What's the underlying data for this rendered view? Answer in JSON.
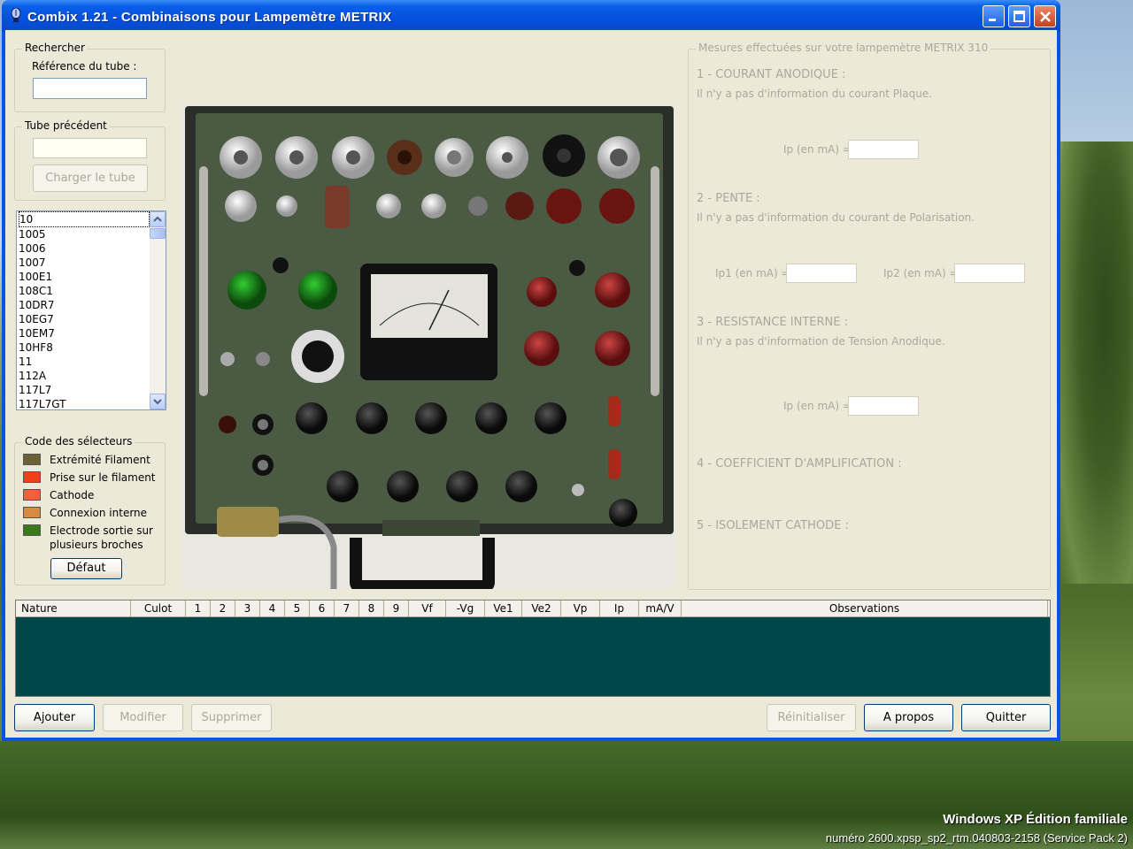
{
  "os": {
    "edition": "Windows XP Édition familiale",
    "build": "numéro 2600.xpsp_sp2_rtm.040803-2158 (Service Pack 2)"
  },
  "window": {
    "title": "Combix 1.21 - Combinaisons pour Lampemètre METRIX",
    "accent": "#0b54e3"
  },
  "search": {
    "group_title": "Rechercher",
    "field_label": "Référence du tube :",
    "value": ""
  },
  "previous": {
    "group_title": "Tube précédent",
    "value": "",
    "load_button": "Charger le tube"
  },
  "tube_list": {
    "selected": "10",
    "items": [
      "10",
      "1005",
      "1006",
      "1007",
      "100E1",
      "108C1",
      "10DR7",
      "10EG7",
      "10EM7",
      "10HF8",
      "11",
      "112A",
      "117L7",
      "117L7GT"
    ]
  },
  "selectors": {
    "group_title": "Code des sélecteurs",
    "items": [
      {
        "label": "Extrémité Filament",
        "color": "#6b6238"
      },
      {
        "label": "Prise sur le filament",
        "color": "#f0401a"
      },
      {
        "label": "Cathode",
        "color": "#f0603a"
      },
      {
        "label": "Connexion interne",
        "color": "#d98a40"
      },
      {
        "label": "Electrode sortie sur",
        "label2": "plusieurs broches",
        "color": "#3a7a1a"
      }
    ],
    "default_button": "Défaut"
  },
  "measures": {
    "group_title": "Mesures effectuées sur votre lampemètre METRIX 310",
    "s1_title": "1 - COURANT ANODIQUE :",
    "s1_text": "Il n'y a pas d'information du courant Plaque.",
    "s1_field": "Ip (en mA) =",
    "s2_title": "2 - PENTE :",
    "s2_text": "Il n'y a pas d'information du courant de Polarisation.",
    "s2_field1": "Ip1 (en mA) =",
    "s2_field2": "Ip2 (en mA) =",
    "s3_title": "3 - RESISTANCE INTERNE :",
    "s3_text": "Il n'y a pas d'information de Tension Anodique.",
    "s3_field": "Ip (en mA) =",
    "s4_title": "4 - COEFFICIENT D'AMPLIFICATION :",
    "s5_title": "5 - ISOLEMENT CATHODE :"
  },
  "grid": {
    "columns": [
      "Nature",
      "Culot",
      "1",
      "2",
      "3",
      "4",
      "5",
      "6",
      "7",
      "8",
      "9",
      "Vf",
      "-Vg",
      "Ve1",
      "Ve2",
      "Vp",
      "Ip",
      "mA/V",
      "Observations"
    ],
    "body_color": "#00474a"
  },
  "buttons": {
    "add": "Ajouter",
    "modify": "Modifier",
    "delete": "Supprimer",
    "reset": "Réinitialiser",
    "about": "A propos",
    "quit": "Quitter"
  }
}
